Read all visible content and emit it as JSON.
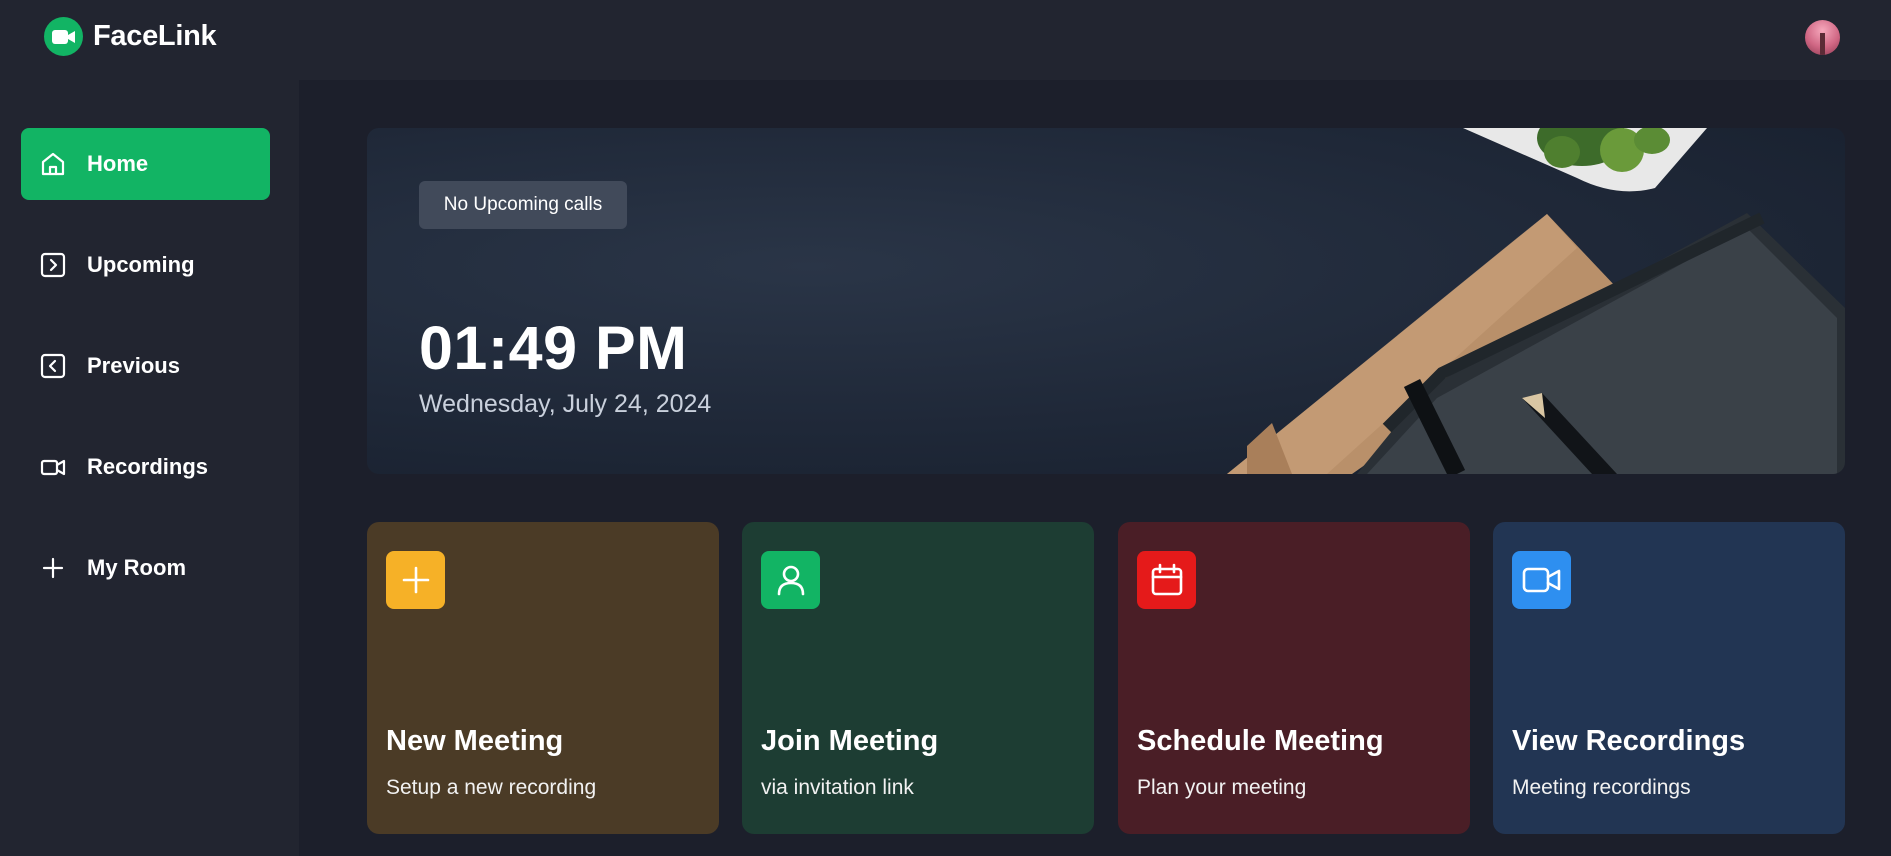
{
  "app": {
    "name": "FaceLink",
    "logo_icon": "video-camera-icon",
    "brand_color": "#12b464"
  },
  "header": {
    "avatar_icon": "user-avatar"
  },
  "sidebar": {
    "items": [
      {
        "label": "Home",
        "icon": "home-icon",
        "active": true
      },
      {
        "label": "Upcoming",
        "icon": "chevron-right-square-icon",
        "active": false
      },
      {
        "label": "Previous",
        "icon": "chevron-left-square-icon",
        "active": false
      },
      {
        "label": "Recordings",
        "icon": "video-camera-icon",
        "active": false
      },
      {
        "label": "My Room",
        "icon": "plus-icon",
        "active": false
      }
    ]
  },
  "hero": {
    "badge": "No Upcoming calls",
    "time": "01:49 PM",
    "date": "Wednesday, July 24, 2024"
  },
  "cards": [
    {
      "title": "New Meeting",
      "subtitle": "Setup a new recording",
      "icon": "plus-icon",
      "bg": "#4b3b26",
      "icon_bg": "#f6b127"
    },
    {
      "title": "Join Meeting",
      "subtitle": "via invitation link",
      "icon": "user-icon",
      "bg": "#1d3d33",
      "icon_bg": "#12b464"
    },
    {
      "title": "Schedule Meeting",
      "subtitle": "Plan your meeting",
      "icon": "calendar-icon",
      "bg": "#4a1e26",
      "icon_bg": "#e51a1a"
    },
    {
      "title": "View Recordings",
      "subtitle": "Meeting recordings",
      "icon": "video-camera-icon",
      "bg": "#223553",
      "icon_bg": "#2e8ff0"
    }
  ]
}
